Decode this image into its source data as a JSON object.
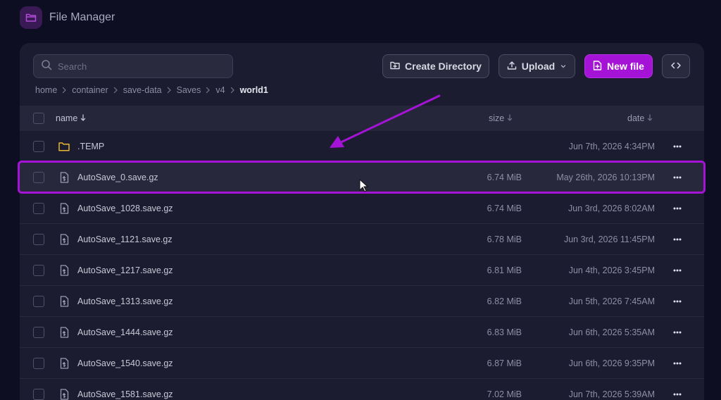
{
  "app": {
    "title": "File Manager"
  },
  "search": {
    "placeholder": "Search"
  },
  "toolbar": {
    "create_label": "Create Directory",
    "upload_label": "Upload",
    "new_file_label": "New file"
  },
  "breadcrumb": [
    "home",
    "container",
    "save-data",
    "Saves",
    "v4",
    "world1"
  ],
  "table": {
    "headers": {
      "name": "name",
      "size": "size",
      "date": "date"
    },
    "rows": [
      {
        "type": "folder",
        "name": ".TEMP",
        "size": "",
        "date": "Jun 7th, 2026 4:34PM"
      },
      {
        "type": "file",
        "name": "AutoSave_0.save.gz",
        "size": "6.74 MiB",
        "date": "May 26th, 2026 10:13PM"
      },
      {
        "type": "file",
        "name": "AutoSave_1028.save.gz",
        "size": "6.74 MiB",
        "date": "Jun 3rd, 2026 8:02AM"
      },
      {
        "type": "file",
        "name": "AutoSave_1121.save.gz",
        "size": "6.78 MiB",
        "date": "Jun 3rd, 2026 11:45PM"
      },
      {
        "type": "file",
        "name": "AutoSave_1217.save.gz",
        "size": "6.81 MiB",
        "date": "Jun 4th, 2026 3:45PM"
      },
      {
        "type": "file",
        "name": "AutoSave_1313.save.gz",
        "size": "6.82 MiB",
        "date": "Jun 5th, 2026 7:45AM"
      },
      {
        "type": "file",
        "name": "AutoSave_1444.save.gz",
        "size": "6.83 MiB",
        "date": "Jun 6th, 2026 5:35AM"
      },
      {
        "type": "file",
        "name": "AutoSave_1540.save.gz",
        "size": "6.87 MiB",
        "date": "Jun 6th, 2026 9:35PM"
      },
      {
        "type": "file",
        "name": "AutoSave_1581.save.gz",
        "size": "7.02 MiB",
        "date": "Jun 7th, 2026 5:39AM"
      }
    ]
  },
  "colors": {
    "accent": "#a514d6",
    "folder": "#e8b82e",
    "background": "#0e0e22",
    "panel": "#1c1c30"
  }
}
